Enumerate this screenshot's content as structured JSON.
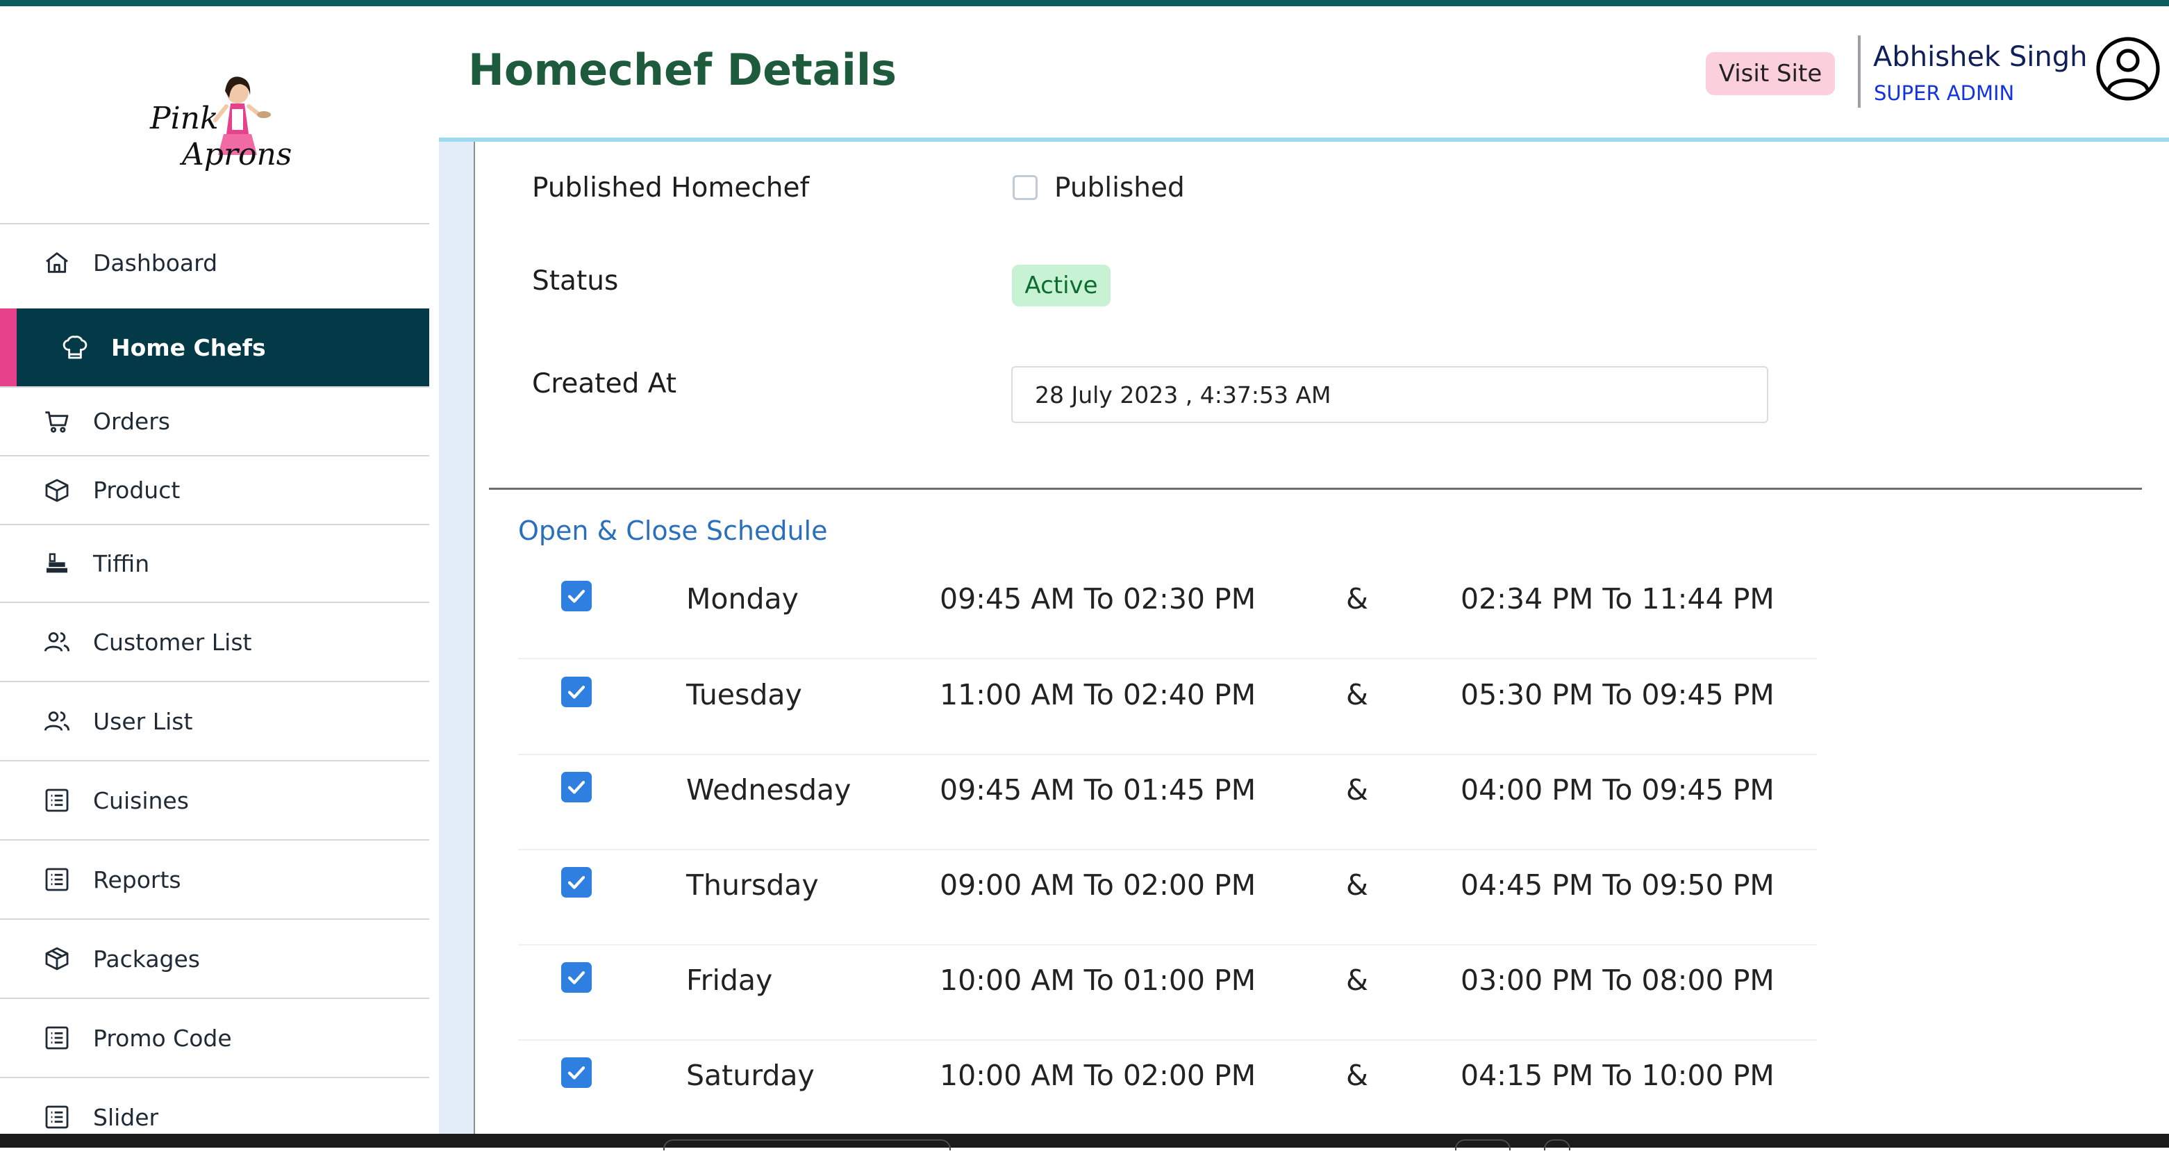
{
  "brand": {
    "logo_line1": "Pink",
    "logo_line2": "Aprons"
  },
  "sidebar": {
    "items": [
      {
        "label": "Dashboard",
        "icon": "home-icon"
      },
      {
        "label": "Home Chefs",
        "icon": "chef-hat-icon",
        "active": true
      },
      {
        "label": "Orders",
        "icon": "cart-icon"
      },
      {
        "label": "Product",
        "icon": "box-icon"
      },
      {
        "label": "Tiffin",
        "icon": "tiffin-icon"
      },
      {
        "label": "Customer List",
        "icon": "users-icon"
      },
      {
        "label": "User List",
        "icon": "users-icon"
      },
      {
        "label": "Cuisines",
        "icon": "list-icon"
      },
      {
        "label": "Reports",
        "icon": "list-icon"
      },
      {
        "label": "Packages",
        "icon": "package-icon"
      },
      {
        "label": "Promo Code",
        "icon": "list-icon"
      },
      {
        "label": "Slider",
        "icon": "list-icon"
      }
    ]
  },
  "header": {
    "title": "Homechef Details",
    "visit_site": "Visit Site",
    "user_name": "Abhishek Singh",
    "user_role": "SUPER ADMIN"
  },
  "details": {
    "published_label": "Published Homechef",
    "published_checkbox_label": "Published",
    "published_checked": false,
    "status_label": "Status",
    "status_value": "Active",
    "created_label": "Created At",
    "created_value": "28 July 2023 , 4:37:53 AM"
  },
  "schedule": {
    "title": "Open & Close Schedule",
    "separator": "&",
    "rows": [
      {
        "day": "Monday",
        "slot1": "09:45 AM To 02:30 PM",
        "slot2": "02:34 PM To 11:44 PM",
        "checked": true
      },
      {
        "day": "Tuesday",
        "slot1": "11:00 AM To 02:40 PM",
        "slot2": "05:30 PM To 09:45 PM",
        "checked": true
      },
      {
        "day": "Wednesday",
        "slot1": "09:45 AM To 01:45 PM",
        "slot2": "04:00 PM To 09:45 PM",
        "checked": true
      },
      {
        "day": "Thursday",
        "slot1": "09:00 AM To 02:00 PM",
        "slot2": "04:45 PM To 09:50 PM",
        "checked": true
      },
      {
        "day": "Friday",
        "slot1": "10:00 AM To 01:00 PM",
        "slot2": "03:00 PM To 08:00 PM",
        "checked": true
      },
      {
        "day": "Saturday",
        "slot1": "10:00 AM To 02:00 PM",
        "slot2": "04:15 PM To 10:00 PM",
        "checked": true
      }
    ]
  },
  "colors": {
    "sidebar_active_bg": "#043a47",
    "sidebar_accent": "#e8418c",
    "title_green": "#1e5a3c",
    "checkbox_blue": "#2f7fe0",
    "status_green_bg": "#c7f2d4"
  }
}
